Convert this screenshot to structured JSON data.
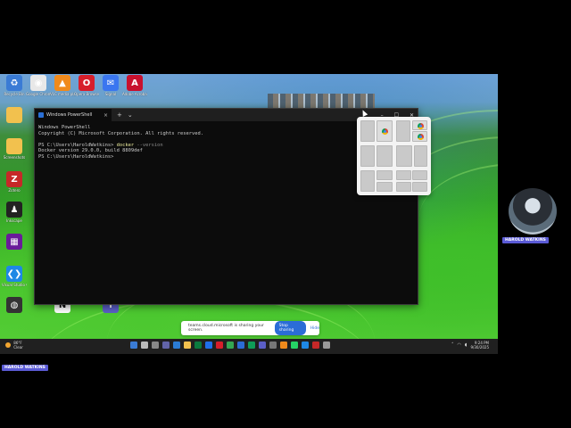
{
  "desktop_icons": [
    {
      "name": "recycle-bin",
      "label": "Recycle Bin",
      "color": "#3a7bd5",
      "glyph": "♻"
    },
    {
      "name": "chrome",
      "label": "Google Chrome",
      "color": "#e8e8e8",
      "glyph": "◉"
    },
    {
      "name": "vlc",
      "label": "VLC media player",
      "color": "#f08a1c",
      "glyph": "▲"
    },
    {
      "name": "opera",
      "label": "Opera Browser",
      "color": "#d71e2b",
      "glyph": "O"
    },
    {
      "name": "signal",
      "label": "Signal",
      "color": "#3a76f0",
      "glyph": "✉"
    },
    {
      "name": "acrobat",
      "label": "Adobe Acrobat",
      "color": "#c8102e",
      "glyph": "A"
    },
    {
      "name": "folder-1",
      "label": "",
      "color": "#f2c14e",
      "glyph": ""
    },
    {
      "name": "folder-2",
      "label": "Screenshots",
      "color": "#f2c14e",
      "glyph": ""
    },
    {
      "name": "zotero",
      "label": "Zotero",
      "color": "#c62828",
      "glyph": "Z"
    },
    {
      "name": "inkscape",
      "label": "Inkscape",
      "color": "#222",
      "glyph": "♟"
    },
    {
      "name": "app-grid",
      "label": "",
      "color": "#6a1b9a",
      "glyph": "▦"
    },
    {
      "name": "vscode",
      "label": "Visual Studio Code",
      "color": "#1e88e5",
      "glyph": "❮❯"
    },
    {
      "name": "obs",
      "label": "",
      "color": "#333",
      "glyph": "◍"
    },
    {
      "name": "notion",
      "label": "",
      "color": "#fff",
      "glyph": "N"
    },
    {
      "name": "teams",
      "label": "",
      "color": "#5b5fc7",
      "glyph": "T"
    }
  ],
  "terminal": {
    "tab_title": "Windows PowerShell",
    "new_tab": "+",
    "dropdown": "⌄",
    "lines": [
      {
        "text": "Windows PowerShell"
      },
      {
        "text": "Copyright (C) Microsoft Corporation. All rights reserved."
      },
      {
        "text": ""
      },
      {
        "prompt": "PS C:\\Users\\HaroldWatkins> ",
        "cmd": "docker",
        "param": " --version"
      },
      {
        "text": "Docker version 29.0.0, build 8809def"
      },
      {
        "text": "PS C:\\Users\\HaroldWatkins>"
      }
    ]
  },
  "share_bar": {
    "message": "teams.cloud.microsoft is sharing your screen.",
    "stop": "Stop sharing",
    "hide": "Hide"
  },
  "taskbar": {
    "weather_temp": "86°F",
    "weather_desc": "Clear",
    "time": "9:24 PM",
    "date": "9/30/2025",
    "icon_colors": [
      "#3a7bd5",
      "#bbb",
      "#888",
      "#6264a7",
      "#2b7cd3",
      "#f2c14e",
      "#0b7a3f",
      "#1f6feb",
      "#d71e2b",
      "#34a853",
      "#2b6cd6",
      "#0f9d58",
      "#5b5fc7",
      "#777",
      "#f08a1c",
      "#25d366",
      "#1e88e5",
      "#c62828",
      "#999"
    ]
  },
  "participant": {
    "name": "HAROLD WATKINS"
  },
  "self_tag": {
    "name": "HAROLD WATKINS"
  }
}
